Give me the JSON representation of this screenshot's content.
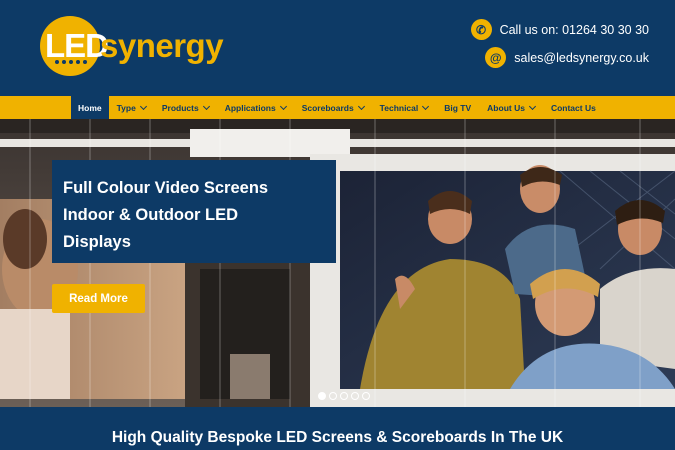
{
  "brand": {
    "logo_led": "LED",
    "logo_synergy": "synergy",
    "yellow": "#f0b200",
    "navy": "#0d3a66"
  },
  "contact": {
    "phone_text": "Call us on: 01264 30 30 30",
    "phone_icon": "phone-icon",
    "phone_glyph": "✆",
    "email_text": "sales@ledsynergy.co.uk",
    "email_icon": "at-icon",
    "email_glyph": "@"
  },
  "nav": {
    "items": [
      {
        "label": "Home",
        "active": true,
        "dropdown": false
      },
      {
        "label": "Type",
        "active": false,
        "dropdown": true
      },
      {
        "label": "Products",
        "active": false,
        "dropdown": true
      },
      {
        "label": "Applications",
        "active": false,
        "dropdown": true
      },
      {
        "label": "Scoreboards",
        "active": false,
        "dropdown": true
      },
      {
        "label": "Technical",
        "active": false,
        "dropdown": true
      },
      {
        "label": "Big TV",
        "active": false,
        "dropdown": false
      },
      {
        "label": "About Us",
        "active": false,
        "dropdown": true
      },
      {
        "label": "Contact Us",
        "active": false,
        "dropdown": false
      }
    ]
  },
  "hero": {
    "caption_line1": "Full Colour Video Screens",
    "caption_line2": "Indoor & Outdoor LED",
    "caption_line3": "Displays",
    "button_label": "Read More",
    "slides": 5,
    "active_slide": 1
  },
  "section": {
    "title": "High Quality Bespoke LED Screens & Scoreboards In The UK"
  }
}
